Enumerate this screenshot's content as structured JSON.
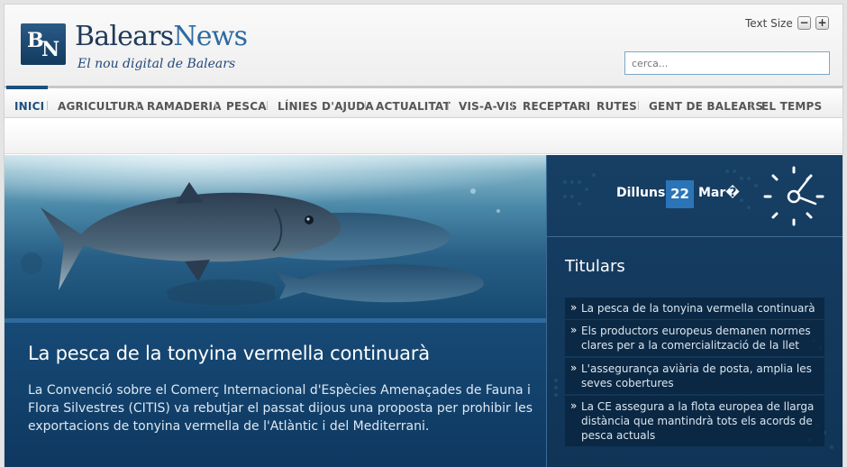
{
  "header": {
    "logo_mark": {
      "letter1": "B",
      "letter2": "N"
    },
    "site_name_part1": "Balears",
    "site_name_part2": "News",
    "tagline": "El nou digital de Balears",
    "text_size_label": "Text Size",
    "text_size_decrease": "−",
    "text_size_increase": "+",
    "search_placeholder": "cerca..."
  },
  "nav": {
    "items": [
      {
        "label": "INICI",
        "active": true
      },
      {
        "label": "AGRICULTURA"
      },
      {
        "label": "RAMADERIA"
      },
      {
        "label": "PESCA"
      },
      {
        "label": "LÍNIES D'AJUDA"
      },
      {
        "label": "ACTUALITAT"
      },
      {
        "label": "VIS-A-VIS"
      },
      {
        "label": "RECEPTARI"
      },
      {
        "label": "RUTES"
      },
      {
        "label": "GENT DE BALEARS"
      },
      {
        "label": "EL TEMPS"
      }
    ]
  },
  "feature": {
    "headline": "La pesca de la tonyina vermella continuarà",
    "summary": "La Convenció sobre el Comerç Internacional d'Espècies Amenaçades de Fauna i Flora Silvestres (CITIS) va rebutjar el passat dijous una proposta per prohibir les exportacions de tonyina vermella de l'Atlàntic i del Mediterrani."
  },
  "sidebar": {
    "date": {
      "day_name": "Dilluns",
      "day_number": "22",
      "month": "Mar�"
    },
    "titulars_heading": "Titulars",
    "headlines": [
      {
        "text": "La pesca de la tonyina vermella continuarà"
      },
      {
        "text": "Els productors europeus demanen normes clares per a la comercialització de la llet"
      },
      {
        "text": "L'assegurança aviària de posta, amplia les seves cobertures"
      },
      {
        "text": "La CE assegura a la flota europea de llarga distància que mantindrà tots els acords de pesca actuals"
      }
    ]
  },
  "icons": {
    "clock": "clock-icon",
    "bullet": "double-chevron-bullet-icon",
    "minus": "minus-icon",
    "plus": "plus-icon"
  },
  "colors": {
    "brand_dark": "#1f3a59",
    "brand_blue": "#2d6aa0",
    "nav_active": "#1f4f7e",
    "feature_bg": "#0e3b63",
    "date_highlight": "#2b74b8"
  }
}
